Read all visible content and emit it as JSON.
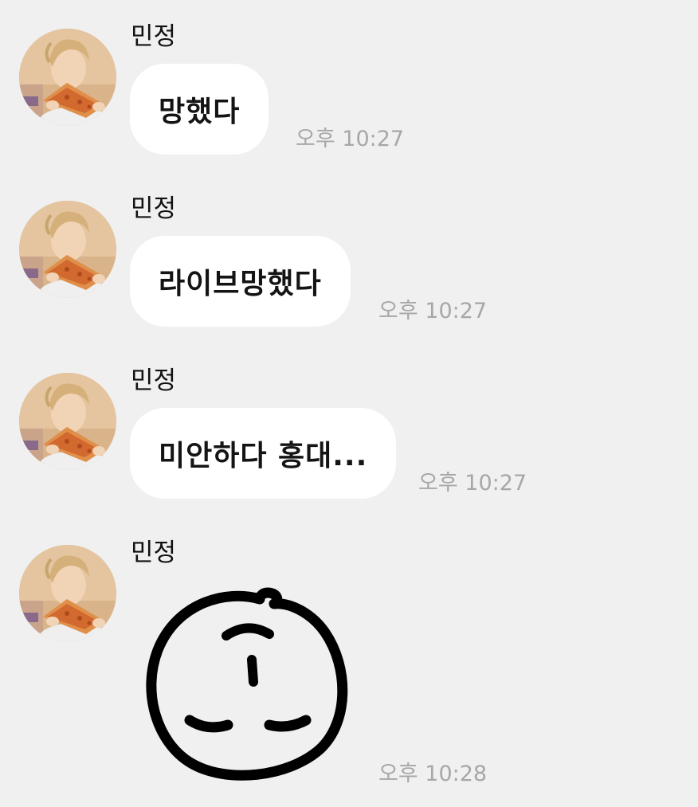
{
  "messages": [
    {
      "sender": "민정",
      "text": "망했다",
      "time": "오후 10:27"
    },
    {
      "sender": "민정",
      "text": "라이브망했다",
      "time": "오후 10:27"
    },
    {
      "sender": "민정",
      "text": "미안하다 홍대...",
      "time": "오후 10:27"
    },
    {
      "sender": "민정",
      "sticker": "sleeping-face-sticker",
      "time": "오후 10:28"
    }
  ],
  "colors": {
    "background": "#f0f0f0",
    "bubble": "#ffffff",
    "timestamp": "#a7a7a7"
  }
}
